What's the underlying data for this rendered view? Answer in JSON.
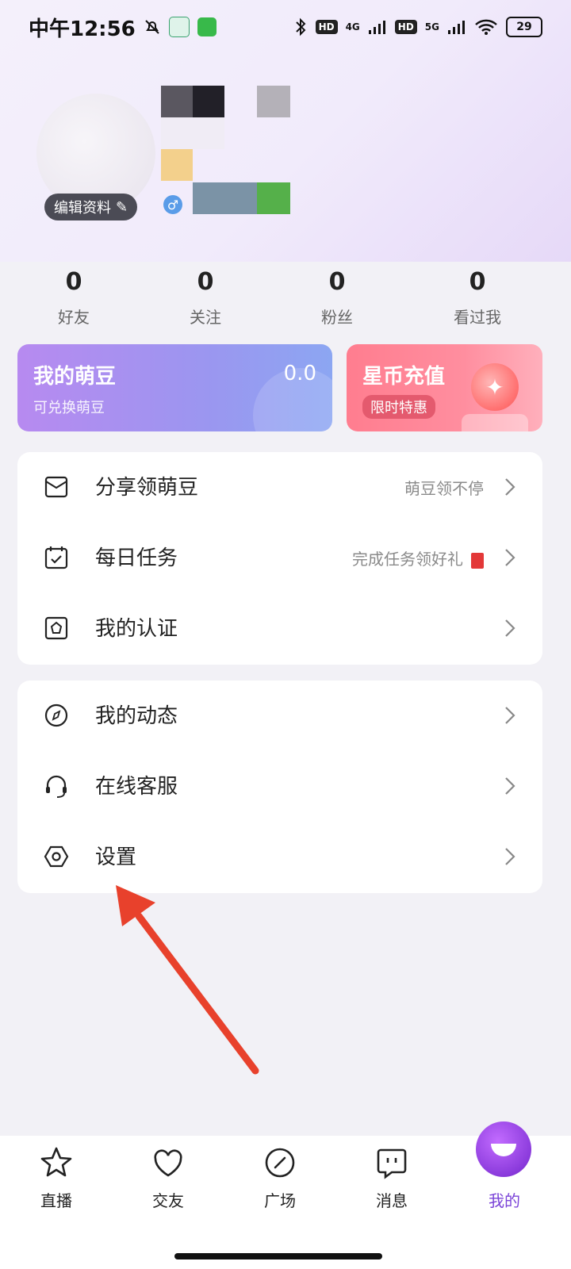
{
  "status_bar": {
    "time": "中午12:56",
    "network_1": "4G",
    "network_2": "5G",
    "hd_1": "HD",
    "hd_2": "HD",
    "battery": "29"
  },
  "profile": {
    "edit_label": "编辑资料",
    "pencil": "✎",
    "gender_symbol": "♂"
  },
  "stats": [
    {
      "value": "0",
      "label": "好友"
    },
    {
      "value": "0",
      "label": "关注"
    },
    {
      "value": "0",
      "label": "粉丝"
    },
    {
      "value": "0",
      "label": "看过我"
    }
  ],
  "cards": {
    "beans": {
      "title": "我的萌豆",
      "subtitle": "可兑换萌豆",
      "value": "0.0"
    },
    "coins": {
      "title": "星币充值",
      "badge": "限时特惠"
    }
  },
  "menu_group_1": [
    {
      "label": "分享领萌豆",
      "hint": "萌豆领不停",
      "icon": "share-envelope-icon"
    },
    {
      "label": "每日任务",
      "hint": "完成任务领好礼",
      "icon": "calendar-check-icon"
    },
    {
      "label": "我的认证",
      "hint": "",
      "icon": "badge-icon"
    }
  ],
  "menu_group_2": [
    {
      "label": "我的动态",
      "hint": "",
      "icon": "compass-icon"
    },
    {
      "label": "在线客服",
      "hint": "",
      "icon": "headset-icon"
    },
    {
      "label": "设置",
      "hint": "",
      "icon": "settings-hex-icon"
    }
  ],
  "bottom_nav": [
    {
      "label": "直播",
      "icon": "star-icon"
    },
    {
      "label": "交友",
      "icon": "heart-icon"
    },
    {
      "label": "广场",
      "icon": "compass-slash-icon"
    },
    {
      "label": "消息",
      "icon": "chat-icon"
    },
    {
      "label": "我的",
      "icon": "profile-bubble-icon",
      "active": true
    }
  ],
  "colors": {
    "accent": "#7b44d8",
    "beans_card": "#a890f0",
    "coins_card": "#ff8a9b",
    "annotation_arrow": "#e8412c"
  }
}
